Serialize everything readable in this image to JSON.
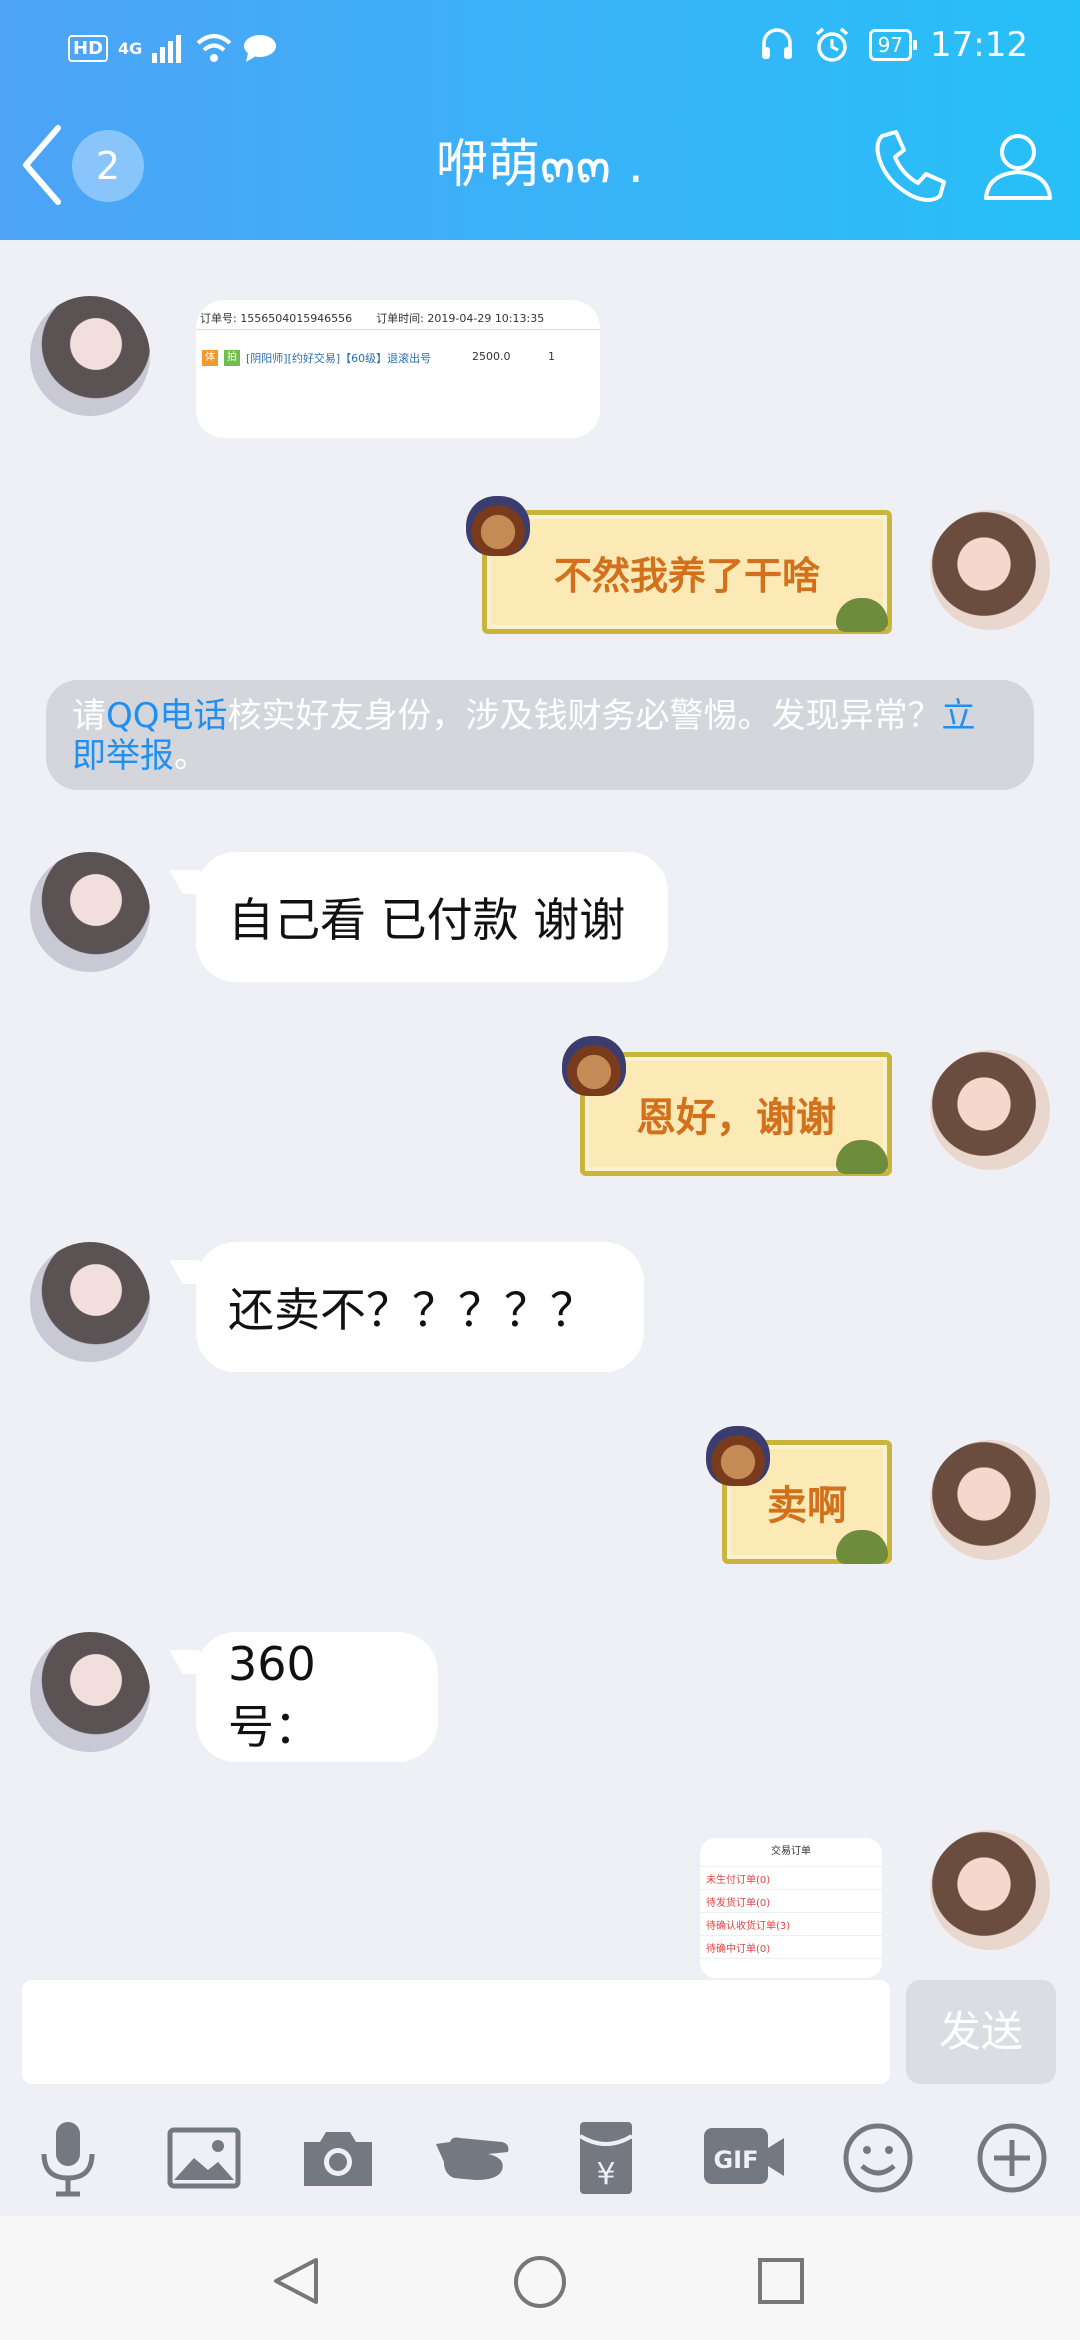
{
  "status_bar": {
    "hd": "HD",
    "network": "4G",
    "battery": "97",
    "time": "17:12"
  },
  "header": {
    "unread_count": "2",
    "title": "咿萌๓๓ ."
  },
  "messages": [
    {
      "side": "left",
      "type": "order-card",
      "order_no_label": "订单号: 1556504015946556",
      "order_time": "订单时间: 2019-04-29 10:13:35",
      "item": "[阴阳师][约好交易]【60级】退滚出号",
      "tag1": "体",
      "tag2": "拍",
      "price": "2500.0",
      "qty": "1"
    },
    {
      "side": "right",
      "type": "sticker",
      "text": "不然我养了干啥"
    },
    {
      "type": "system",
      "text_a": "请",
      "link_a": "QQ电话",
      "text_b": "核实好友身份，涉及钱财务必警惕。发现异常？",
      "link_b": "立即举报",
      "text_c": "。"
    },
    {
      "side": "left",
      "type": "text",
      "text": "自己看 已付款 谢谢"
    },
    {
      "side": "right",
      "type": "sticker",
      "text": "恩好，谢谢"
    },
    {
      "side": "left",
      "type": "text",
      "text": "还卖不？？？？？"
    },
    {
      "side": "right",
      "type": "sticker",
      "text": "卖啊"
    },
    {
      "side": "left",
      "type": "text",
      "text": "360号："
    },
    {
      "side": "right",
      "type": "image",
      "title": "交易订单",
      "rows": [
        "未生付订单(0)",
        "待发货订单(0)",
        "待确认收货订单(3)",
        "待确中订单(0)"
      ]
    }
  ],
  "composer": {
    "placeholder": "",
    "send_label": "发送"
  },
  "toolbar_icons": [
    "microphone-icon",
    "image-icon",
    "camera-icon",
    "poke-hand-icon",
    "red-packet-icon",
    "gif-icon",
    "emoji-icon",
    "plus-icon"
  ],
  "colors": {
    "header_start": "#4ea3f7",
    "header_end": "#26c0f8",
    "link": "#1f8ff0",
    "sticker_text": "#d2701c"
  }
}
